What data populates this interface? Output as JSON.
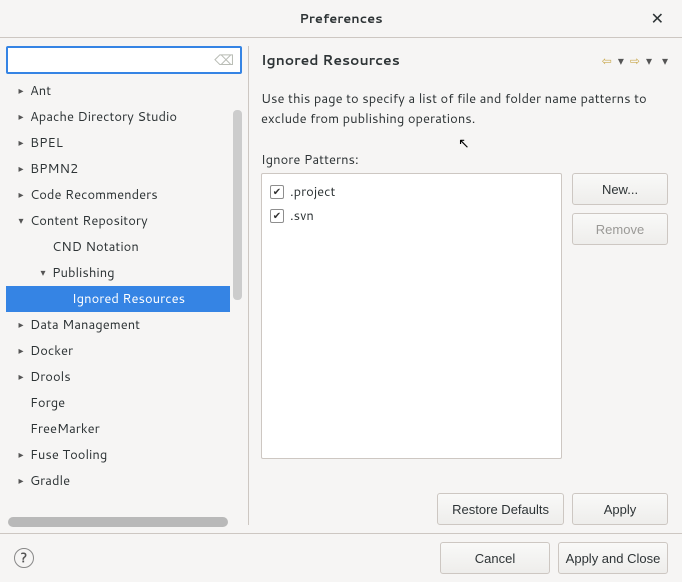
{
  "window": {
    "title": "Preferences"
  },
  "filter": {
    "placeholder": ""
  },
  "tree": [
    {
      "label": "Ant",
      "indent": 0,
      "arrow": "▸",
      "selected": false
    },
    {
      "label": "Apache Directory Studio",
      "indent": 0,
      "arrow": "▸",
      "selected": false
    },
    {
      "label": "BPEL",
      "indent": 0,
      "arrow": "▸",
      "selected": false
    },
    {
      "label": "BPMN2",
      "indent": 0,
      "arrow": "▸",
      "selected": false
    },
    {
      "label": "Code Recommenders",
      "indent": 0,
      "arrow": "▸",
      "selected": false
    },
    {
      "label": "Content Repository",
      "indent": 0,
      "arrow": "▾",
      "selected": false
    },
    {
      "label": "CND Notation",
      "indent": 1,
      "arrow": "",
      "selected": false
    },
    {
      "label": "Publishing",
      "indent": 1,
      "arrow": "▾",
      "selected": false
    },
    {
      "label": "Ignored Resources",
      "indent": 2,
      "arrow": "",
      "selected": true
    },
    {
      "label": "Data Management",
      "indent": 0,
      "arrow": "▸",
      "selected": false
    },
    {
      "label": "Docker",
      "indent": 0,
      "arrow": "▸",
      "selected": false
    },
    {
      "label": "Drools",
      "indent": 0,
      "arrow": "▸",
      "selected": false
    },
    {
      "label": "Forge",
      "indent": 0,
      "arrow": "",
      "selected": false
    },
    {
      "label": "FreeMarker",
      "indent": 0,
      "arrow": "",
      "selected": false
    },
    {
      "label": "Fuse Tooling",
      "indent": 0,
      "arrow": "▸",
      "selected": false
    },
    {
      "label": "Gradle",
      "indent": 0,
      "arrow": "▸",
      "selected": false
    }
  ],
  "page": {
    "heading": "Ignored Resources",
    "description": "Use this page to specify a list of file and folder name patterns to exclude from publishing operations.",
    "patterns_label": "Ignore Patterns:",
    "patterns": [
      {
        "label": ".project",
        "checked": true
      },
      {
        "label": ".svn",
        "checked": true
      }
    ]
  },
  "buttons": {
    "new": "New...",
    "remove": "Remove",
    "restore_defaults": "Restore Defaults",
    "apply": "Apply",
    "cancel": "Cancel",
    "apply_and_close": "Apply and Close"
  }
}
